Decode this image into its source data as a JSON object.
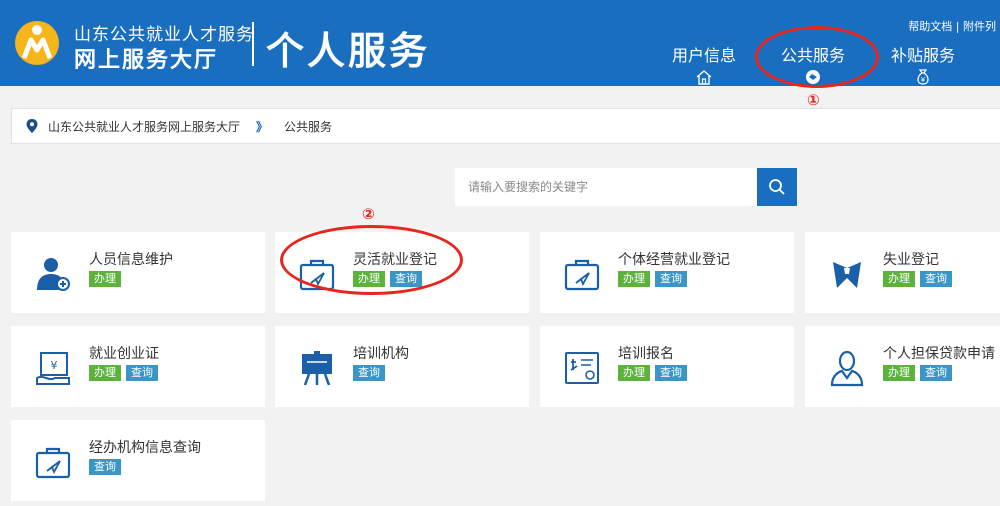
{
  "header": {
    "brand_line1": "山东公共就业人才服务",
    "brand_line2": "网上服务大厅",
    "title": "个人服务",
    "top_links": "帮助文档 | 附件列",
    "nav": [
      {
        "label": "用户信息",
        "icon": "home-icon"
      },
      {
        "label": "公共服务",
        "icon": "service-icon"
      },
      {
        "label": "补贴服务",
        "icon": "money-bag-icon"
      }
    ]
  },
  "annotations": {
    "one": "①",
    "two": "②"
  },
  "breadcrumb": {
    "home": "山东公共就业人才服务网上服务大厅",
    "separator": "》",
    "current": "公共服务"
  },
  "search": {
    "placeholder": "请输入要搜索的关键字"
  },
  "cards": [
    {
      "title": "人员信息维护",
      "do": "办理",
      "icon": "person-icon"
    },
    {
      "title": "灵活就业登记",
      "do": "办理",
      "query": "查询",
      "icon": "briefcase-icon"
    },
    {
      "title": "个体经营就业登记",
      "do": "办理",
      "query": "查询",
      "icon": "briefcase-icon"
    },
    {
      "title": "失业登记",
      "do": "办理",
      "query": "查询",
      "icon": "tie-icon"
    },
    {
      "title": "就业创业证",
      "do": "办理",
      "query": "查询",
      "icon": "certificate-icon"
    },
    {
      "title": "培训机构",
      "query": "查询",
      "icon": "easel-icon"
    },
    {
      "title": "培训报名",
      "do": "办理",
      "query": "查询",
      "icon": "training-icon"
    },
    {
      "title": "个人担保贷款申请",
      "do": "办理",
      "query": "查询",
      "icon": "person-outline-icon"
    },
    {
      "title": "经办机构信息查询",
      "query": "查询",
      "icon": "briefcase-icon"
    }
  ],
  "colors": {
    "header_bg": "#1a6ec0",
    "annotation": "#e8261e",
    "do_btn": "#5bb33c",
    "query_btn": "#3a96c6"
  }
}
